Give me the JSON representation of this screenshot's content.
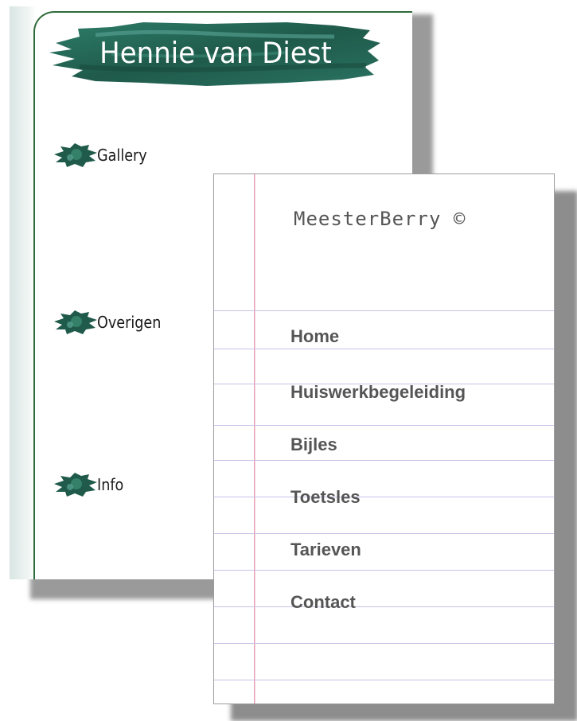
{
  "back_site": {
    "title": "Hennie van Diest",
    "nav": [
      {
        "label": "Gallery",
        "icon": "brush-blot-icon"
      },
      {
        "label": "Overigen",
        "icon": "brush-blot-icon"
      },
      {
        "label": "Info",
        "icon": "brush-blot-icon"
      }
    ],
    "colors": {
      "brush_dark": "#1f5a4a",
      "brush_mid": "#2e7d6a",
      "brush_light": "#5aa597",
      "border": "#2f6b3a"
    }
  },
  "front_site": {
    "brand": "MeesterBerry ©",
    "nav": [
      {
        "label": "Home"
      },
      {
        "label": "Huiswerkbegeleiding"
      },
      {
        "label": "Bijles"
      },
      {
        "label": "Toetsles"
      },
      {
        "label": "Tarieven"
      },
      {
        "label": "Contact"
      }
    ],
    "colors": {
      "rule": "#c7c2e6",
      "margin": "#e7a0b4",
      "text": "#555555"
    }
  }
}
